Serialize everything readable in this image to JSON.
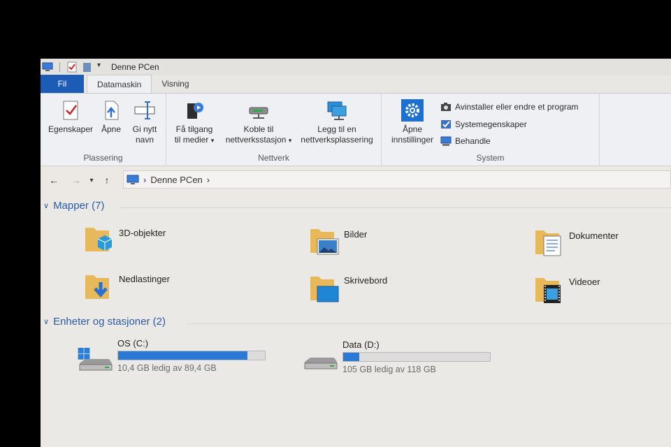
{
  "window": {
    "title": "Denne PCen"
  },
  "ribbon": {
    "tabs": [
      {
        "label": "Fil"
      },
      {
        "label": "Datamaskin"
      },
      {
        "label": "Visning"
      }
    ],
    "groups": {
      "plassering": {
        "label": "Plassering",
        "buttons": [
          {
            "label": "Egenskaper"
          },
          {
            "label": "Åpne"
          },
          {
            "line1": "Gi nytt",
            "line2": "navn"
          }
        ]
      },
      "nettverk": {
        "label": "Nettverk",
        "buttons": [
          {
            "line1": "Få tilgang",
            "line2": "til medier",
            "dropdown": "▾"
          },
          {
            "line1": "Koble til",
            "line2": "nettverksstasjon",
            "dropdown": "▾"
          },
          {
            "line1": "Legg til en",
            "line2": "nettverksplassering"
          }
        ]
      },
      "system": {
        "label": "System",
        "open_settings": {
          "line1": "Åpne",
          "line2": "innstillinger"
        },
        "items": [
          {
            "label": "Avinstaller eller endre et program"
          },
          {
            "label": "Systemegenskaper"
          },
          {
            "label": "Behandle"
          }
        ]
      }
    }
  },
  "address": {
    "path": "Denne PCen",
    "back_icon": "←",
    "forward_icon": "→",
    "recent_icon": "▾",
    "up_icon": "↑",
    "sep": "›"
  },
  "folders": {
    "header": "Mapper (7)",
    "items": [
      {
        "name": "3D-objekter"
      },
      {
        "name": "Bilder"
      },
      {
        "name": "Dokumenter"
      },
      {
        "name": "Nedlastinger"
      },
      {
        "name": "Skrivebord"
      },
      {
        "name": "Videoer"
      }
    ]
  },
  "drives": {
    "header": "Enheter og stasjoner (2)",
    "items": [
      {
        "name": "OS (C:)",
        "free": "10,4 GB ledig av 89,4 GB",
        "used_fraction": 0.88
      },
      {
        "name": "Data (D:)",
        "free": "105 GB ledig av 118 GB",
        "used_fraction": 0.11
      }
    ]
  },
  "colors": {
    "accent": "#1c5bb6",
    "bar": "#2b79d6",
    "section": "#2a5aa8"
  }
}
